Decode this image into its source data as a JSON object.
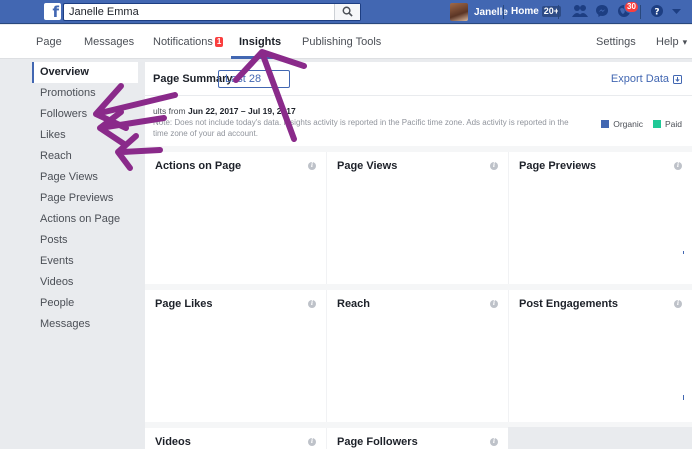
{
  "topbar": {
    "search_value": "Janelle Emma",
    "user_name": "Janelle",
    "home_label": "Home",
    "home_count": "20+",
    "notification_count": "30",
    "brand_color": "#4267b2"
  },
  "nav": {
    "tabs": [
      {
        "label": "Page"
      },
      {
        "label": "Messages"
      },
      {
        "label": "Notifications",
        "badge": "1"
      },
      {
        "label": "Insights"
      },
      {
        "label": "Publishing Tools"
      }
    ],
    "settings_label": "Settings",
    "help_label": "Help"
  },
  "sidebar": {
    "items": [
      {
        "label": "Overview"
      },
      {
        "label": "Promotions"
      },
      {
        "label": "Followers"
      },
      {
        "label": "Likes"
      },
      {
        "label": "Reach"
      },
      {
        "label": "Page Views"
      },
      {
        "label": "Page Previews"
      },
      {
        "label": "Actions on Page"
      },
      {
        "label": "Posts"
      },
      {
        "label": "Events"
      },
      {
        "label": "Videos"
      },
      {
        "label": "People"
      },
      {
        "label": "Messages"
      }
    ]
  },
  "summary": {
    "title": "Page Summary",
    "range_label": "Last 28",
    "export_label": "Export Data",
    "results_prefix": "ults from",
    "results_range": "Jun 22, 2017 – Jul 19, 2017",
    "note": "Note: Does not include today's data. Insights activity is reported in the Pacific time zone. Ads activity is reported in the time zone of your ad account.",
    "legend": [
      {
        "label": "Organic",
        "color": "#4267b2"
      },
      {
        "label": "Paid",
        "color": "#20c997"
      }
    ]
  },
  "cards": [
    {
      "title": "Actions on Page"
    },
    {
      "title": "Page Views"
    },
    {
      "title": "Page Previews"
    },
    {
      "title": "Page Likes"
    },
    {
      "title": "Reach"
    },
    {
      "title": "Post Engagements"
    },
    {
      "title": "Videos"
    },
    {
      "title": "Page Followers"
    }
  ],
  "annotation_color": "#8a2a8a"
}
